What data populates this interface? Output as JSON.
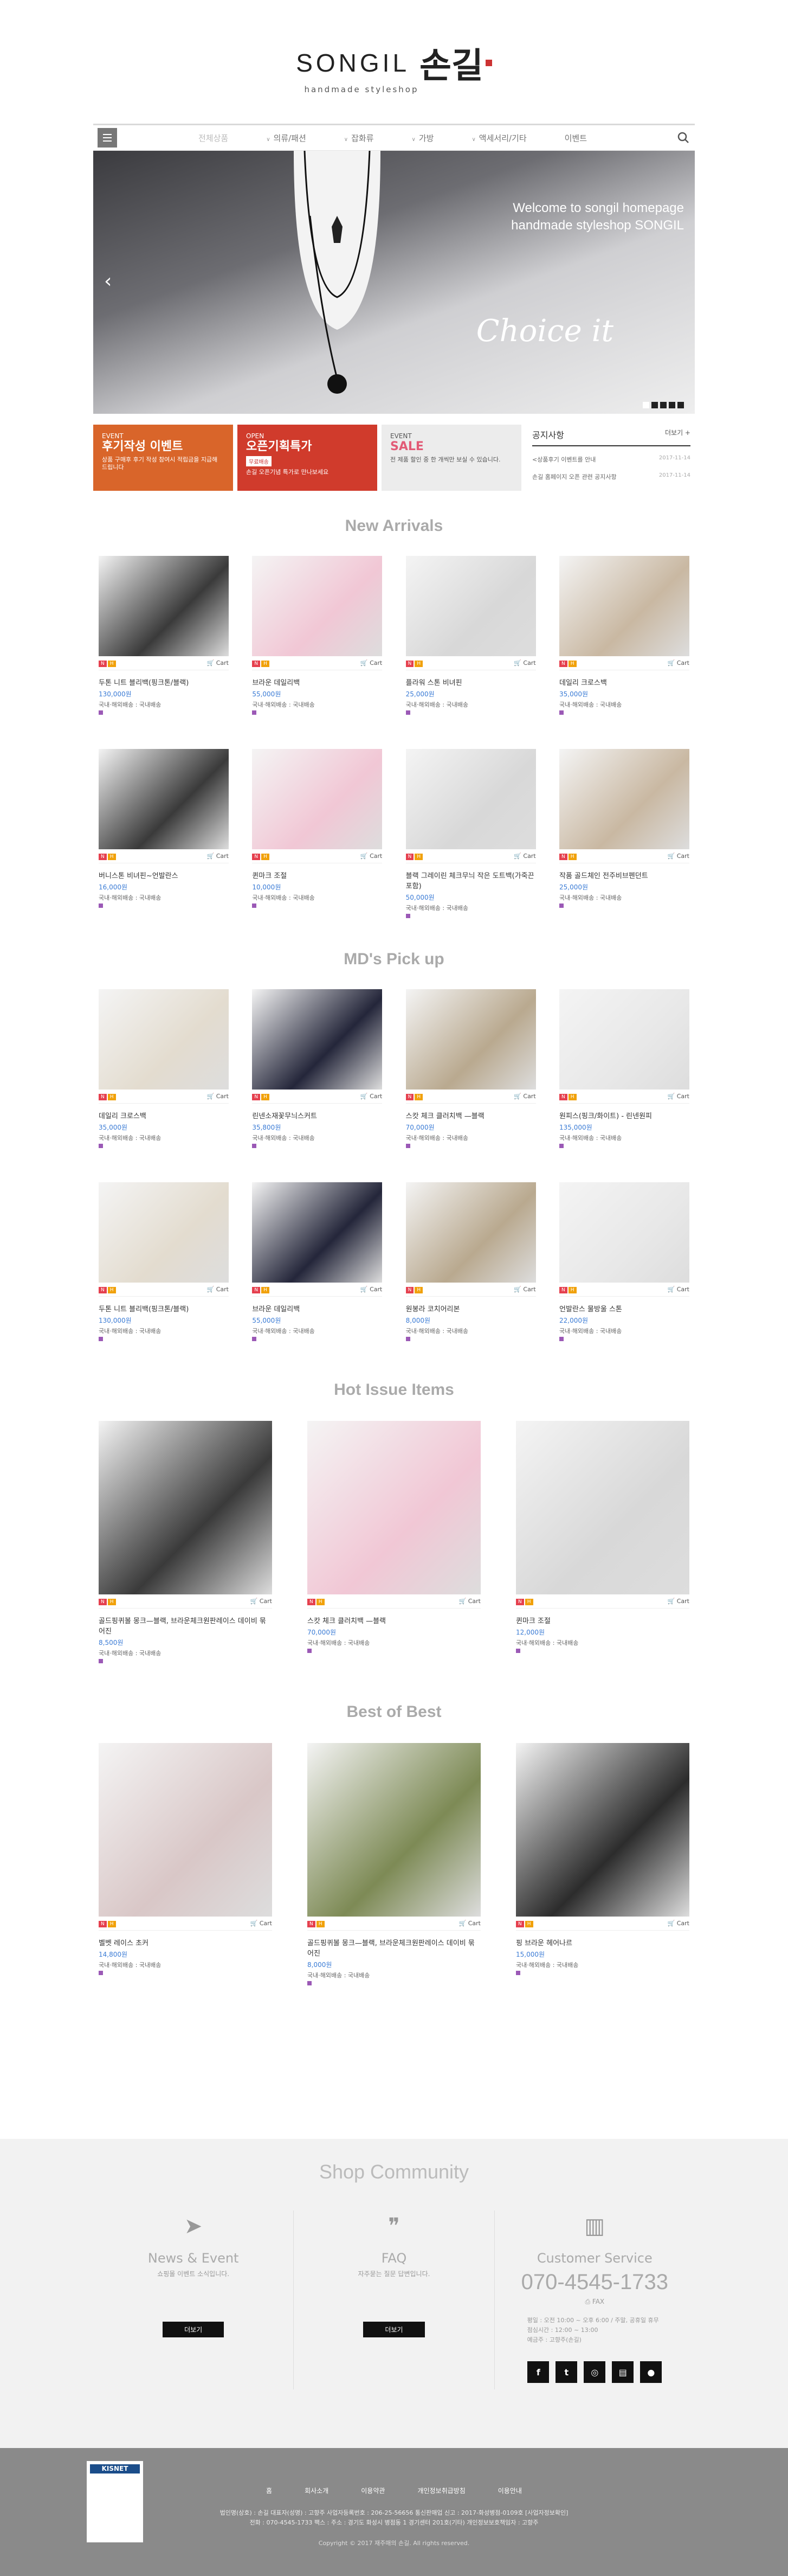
{
  "brand": {
    "name_en": "SONGIL",
    "name_kr": "손길",
    "tagline": "handmade styleshop"
  },
  "nav": {
    "items": [
      "전체상품",
      "의류/패션",
      "잡화류",
      "가방",
      "액세서리/기타",
      "이벤트"
    ]
  },
  "hero": {
    "line1": "Welcome to songil homepage",
    "line2": "handmade styleshop SONGIL",
    "script": "Choice it"
  },
  "promos": [
    {
      "t1": "EVENT",
      "t2": "후기작성 이벤트",
      "t3": "상품 구매후 후기 작성 참여시 적립금을 지급해 드립니다"
    },
    {
      "t1": "OPEN",
      "t2": "오픈기획특가",
      "tag": "무료배송",
      "t3": "손길 오픈기념 특가로 만나보세요"
    },
    {
      "t1": "EVENT",
      "t2": "SALE",
      "t3": "전 제품 할인 중 한 개씩만 보실 수 있습니다."
    }
  ],
  "notice": {
    "title": "공지사항",
    "more": "더보기 +",
    "rows": [
      {
        "text": "<상품후기 이벤트를 안내",
        "date": "2017-11-14"
      },
      {
        "text": "손길 홈페이지 오픈 관련 공지사항",
        "date": "2017-11-14"
      }
    ]
  },
  "sections": {
    "new": "New Arrivals",
    "md": "MD's Pick up",
    "hot": "Hot Issue Items",
    "best": "Best of Best"
  },
  "cart_label": "Cart",
  "ship": "국내·해외배송 : 국내배송",
  "new_items": [
    {
      "name": "두톤 니트 블리백(핑크톤/블랙)",
      "price": "130,000원"
    },
    {
      "name": "브라운 데일리백",
      "price": "55,000원"
    },
    {
      "name": "플라워 스톤 비녀핀",
      "price": "25,000원"
    },
    {
      "name": "데일리 크로스백",
      "price": "35,000원"
    },
    {
      "name": "버니스톤 비녀핀~언발란스",
      "price": "16,000원"
    },
    {
      "name": "퀸마크 조절",
      "price": "10,000원"
    },
    {
      "name": "블랙 그레이린 체크무늬 작은 도트백(가죽끈 포함)",
      "price": "50,000원"
    },
    {
      "name": "작품 골드체인 전주비브펜던트",
      "price": "25,000원"
    }
  ],
  "md_items": [
    {
      "name": "데일리 크로스백",
      "price": "35,000원"
    },
    {
      "name": "린넨소재꽃무늬스커트",
      "price": "35,800원"
    },
    {
      "name": "스캇 체크 클러치백 —블랙",
      "price": "70,000원"
    },
    {
      "name": "원피스(핑크/화이트) - 린넨원피",
      "price": "135,000원"
    },
    {
      "name": "두톤 니트 블리백(핑크톤/블랙)",
      "price": "130,000원"
    },
    {
      "name": "브라운 데일리백",
      "price": "55,000원"
    },
    {
      "name": "원봉라 코치어리본",
      "price": "8,000원"
    },
    {
      "name": "언발란스 물방울 스톤",
      "price": "22,000원"
    }
  ],
  "hot_items": [
    {
      "name": "골드핑퀴볼 몽크—블랙, 브라운체크원판레이스 데이비 묶어진",
      "price": "8,500원"
    },
    {
      "name": "스캇 체크 클러치백 —블랙",
      "price": "70,000원"
    },
    {
      "name": "퀸마크 조절",
      "price": "12,000원"
    }
  ],
  "best_items": [
    {
      "name": "벨벳 레이스 초커",
      "price": "14,800원"
    },
    {
      "name": "골드핑퀴볼 몽크—블랙, 브라운체크원판레이스 데이비 묶어진",
      "price": "8,000원"
    },
    {
      "name": "핑 브라운 헤어나르",
      "price": "15,000원"
    }
  ],
  "community": {
    "title": "Shop Community",
    "news": {
      "title": "News & Event",
      "desc": "쇼핑몰 이벤트 소식입니다.",
      "more": "더보기"
    },
    "faq": {
      "title": "FAQ",
      "desc": "자주묻는 질문 답변입니다.",
      "more": "더보기"
    },
    "cs": {
      "title": "Customer Service",
      "phone": "070-4545-1733",
      "fax": "FAX",
      "hours1": "평일 : 오전 10:00 ~ 오후 6:00 / 주말, 공휴일 휴무",
      "hours2": "점심시간 : 12:00 ~ 13:00",
      "hours3": "예금주 : 고향주(손길)"
    }
  },
  "footer": {
    "links": [
      "홈",
      "회사소개",
      "이용약관",
      "개인정보취급방침",
      "이용안내"
    ],
    "info1": "법인명(상호) : 손길  대표자(성명) : 고향주  사업자등록번호 : 206-25-56656  통신판매업 신고 : 2017-화성병점-0109호 [사업자정보확인]",
    "info2": "전화 : 070-4545-1733  팩스 :  주소 : 경기도 화성시 병점동 1 경기센터 201호(기타)  개인정보보호책임자 : 고향주",
    "copy": "Copyright © 2017 재주매의 손길. All rights reserved.",
    "kisnet": "KISNET"
  },
  "colors": {
    "accent": "#3a7bd5",
    "badge_red": "#e5404e",
    "badge_yellow": "#f1a10a"
  }
}
